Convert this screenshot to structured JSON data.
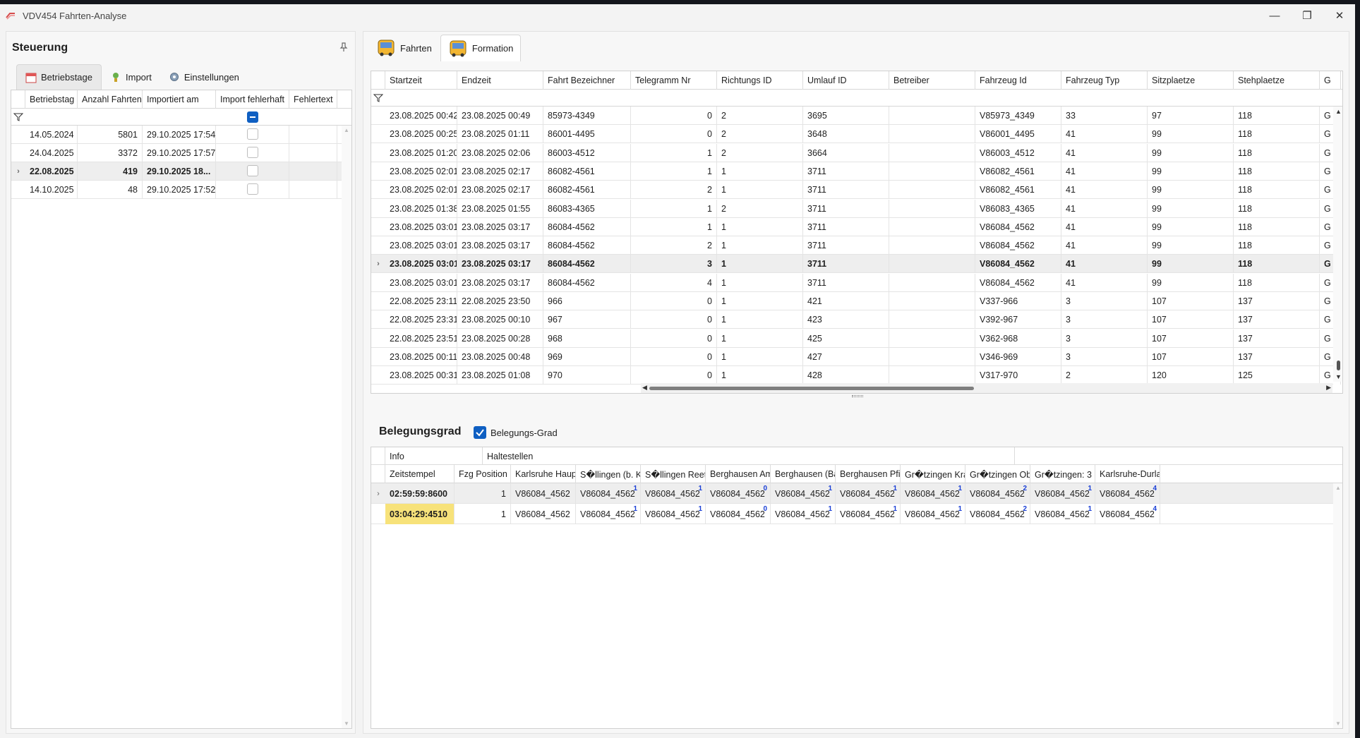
{
  "window": {
    "title": "VDV454 Fahrten-Analyse",
    "controls": [
      "—",
      "❐",
      "✕"
    ]
  },
  "left": {
    "title": "Steuerung",
    "tabs": [
      {
        "label": "Betriebstage",
        "icon": "calendar-icon"
      },
      {
        "label": "Import",
        "icon": "import-icon"
      },
      {
        "label": "Einstellungen",
        "icon": "gear-icon"
      }
    ],
    "columns": [
      "Betriebstag",
      "Anzahl Fahrten",
      "Importiert am",
      "Import fehlerhaft",
      "Fehlertext"
    ],
    "rows": [
      {
        "date": "14.05.2024",
        "count": "5801",
        "imported": "29.10.2025 17:54",
        "err": false,
        "text": ""
      },
      {
        "date": "24.04.2025",
        "count": "3372",
        "imported": "29.10.2025 17:57",
        "err": false,
        "text": ""
      },
      {
        "date": "22.08.2025",
        "count": "419",
        "imported": "29.10.2025 18...",
        "err": false,
        "text": "",
        "selected": true
      },
      {
        "date": "14.10.2025",
        "count": "48",
        "imported": "29.10.2025 17:52",
        "err": false,
        "text": ""
      }
    ]
  },
  "right": {
    "tabs": [
      {
        "label": "Fahrten"
      },
      {
        "label": "Formation"
      }
    ],
    "columns": [
      "Startzeit",
      "Endzeit",
      "Fahrt Bezeichner",
      "Telegramm Nr",
      "Richtungs ID",
      "Umlauf ID",
      "Betreiber",
      "Fahrzeug Id",
      "Fahrzeug Typ",
      "Sitzplaetze",
      "Stehplaetze",
      "G"
    ],
    "rows": [
      [
        "23.08.2025 00:42",
        "23.08.2025 00:49",
        "85973-4349",
        "0",
        "2",
        "3695",
        "",
        "V85973_4349",
        "33",
        "97",
        "118",
        "G"
      ],
      [
        "23.08.2025 00:25",
        "23.08.2025 01:11",
        "86001-4495",
        "0",
        "2",
        "3648",
        "",
        "V86001_4495",
        "41",
        "99",
        "118",
        "G"
      ],
      [
        "23.08.2025 01:20",
        "23.08.2025 02:06",
        "86003-4512",
        "1",
        "2",
        "3664",
        "",
        "V86003_4512",
        "41",
        "99",
        "118",
        "G"
      ],
      [
        "23.08.2025 02:01",
        "23.08.2025 02:17",
        "86082-4561",
        "1",
        "1",
        "3711",
        "",
        "V86082_4561",
        "41",
        "99",
        "118",
        "G"
      ],
      [
        "23.08.2025 02:01",
        "23.08.2025 02:17",
        "86082-4561",
        "2",
        "1",
        "3711",
        "",
        "V86082_4561",
        "41",
        "99",
        "118",
        "G"
      ],
      [
        "23.08.2025 01:38",
        "23.08.2025 01:55",
        "86083-4365",
        "1",
        "2",
        "3711",
        "",
        "V86083_4365",
        "41",
        "99",
        "118",
        "G"
      ],
      [
        "23.08.2025 03:01",
        "23.08.2025 03:17",
        "86084-4562",
        "1",
        "1",
        "3711",
        "",
        "V86084_4562",
        "41",
        "99",
        "118",
        "G"
      ],
      [
        "23.08.2025 03:01",
        "23.08.2025 03:17",
        "86084-4562",
        "2",
        "1",
        "3711",
        "",
        "V86084_4562",
        "41",
        "99",
        "118",
        "G"
      ],
      [
        "23.08.2025 03:01",
        "23.08.2025 03:17",
        "86084-4562",
        "3",
        "1",
        "3711",
        "",
        "V86084_4562",
        "41",
        "99",
        "118",
        "G"
      ],
      [
        "23.08.2025 03:01",
        "23.08.2025 03:17",
        "86084-4562",
        "4",
        "1",
        "3711",
        "",
        "V86084_4562",
        "41",
        "99",
        "118",
        "G"
      ],
      [
        "22.08.2025 23:11",
        "22.08.2025 23:50",
        "966",
        "0",
        "1",
        "421",
        "",
        "V337-966",
        "3",
        "107",
        "137",
        "G"
      ],
      [
        "22.08.2025 23:31",
        "23.08.2025 00:10",
        "967",
        "0",
        "1",
        "423",
        "",
        "V392-967",
        "3",
        "107",
        "137",
        "G"
      ],
      [
        "22.08.2025 23:51",
        "23.08.2025 00:28",
        "968",
        "0",
        "1",
        "425",
        "",
        "V362-968",
        "3",
        "107",
        "137",
        "G"
      ],
      [
        "23.08.2025 00:11",
        "23.08.2025 00:48",
        "969",
        "0",
        "1",
        "427",
        "",
        "V346-969",
        "3",
        "107",
        "137",
        "G"
      ],
      [
        "23.08.2025 00:31",
        "23.08.2025 01:08",
        "970",
        "0",
        "1",
        "428",
        "",
        "V317-970",
        "2",
        "120",
        "125",
        "G"
      ]
    ],
    "selected_row": 8,
    "beleg": {
      "title": "Belegungsgrad",
      "checkbox_label": "Belegungs-Grad",
      "checked": true,
      "band_info": "Info",
      "band_stops": "Haltestellen",
      "columns": [
        "Zeitstempel",
        "Fzg Position",
        "Karlsruhe Haup",
        "S�llingen (b. K",
        "S�llingen Reet",
        "Berghausen Am",
        "Berghausen (Ba",
        "Berghausen Pfi",
        "Gr�tzingen Kra",
        "Gr�tzingen Ob",
        "Gr�tzingen: 3",
        "Karlsruhe-Durla"
      ],
      "rows": [
        {
          "ts": "02:59:59:8600",
          "pos": "1",
          "cells": [
            [
              "V86084_4562",
              ""
            ],
            [
              "V86084_4562",
              "1"
            ],
            [
              "V86084_4562",
              "1"
            ],
            [
              "V86084_4562",
              "0"
            ],
            [
              "V86084_4562",
              "1"
            ],
            [
              "V86084_4562",
              "1"
            ],
            [
              "V86084_4562",
              "1"
            ],
            [
              "V86084_4562",
              "2"
            ],
            [
              "V86084_4562",
              "1"
            ],
            [
              "V86084_4562",
              "4"
            ]
          ]
        },
        {
          "ts": "03:04:29:4510",
          "pos": "1",
          "cells": [
            [
              "V86084_4562",
              ""
            ],
            [
              "V86084_4562",
              "1"
            ],
            [
              "V86084_4562",
              "1"
            ],
            [
              "V86084_4562",
              "0"
            ],
            [
              "V86084_4562",
              "1"
            ],
            [
              "V86084_4562",
              "1"
            ],
            [
              "V86084_4562",
              "1"
            ],
            [
              "V86084_4562",
              "2"
            ],
            [
              "V86084_4562",
              "1"
            ],
            [
              "V86084_4562",
              "4"
            ]
          ],
          "highlight": true
        }
      ]
    }
  },
  "colors": {
    "accent": "#0f5fc2",
    "highlight": "#f7e27a",
    "badge": "#1a3fd6"
  }
}
